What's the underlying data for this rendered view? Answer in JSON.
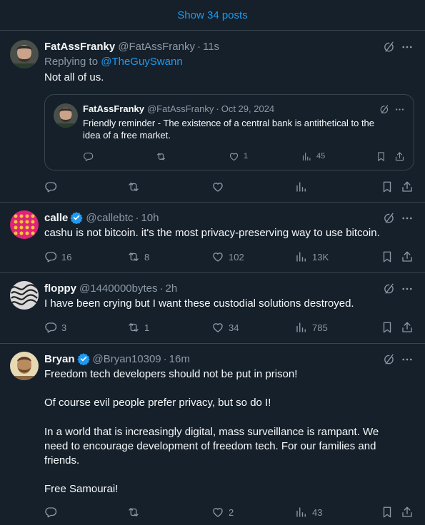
{
  "show_more": {
    "label": "Show 34 posts"
  },
  "post1": {
    "name": "FatAssFranky",
    "handle": "@FatAssFranky",
    "time": "11s",
    "replying_prefix": "Replying to ",
    "replying_handle": "@TheGuySwann",
    "text": "Not all of us.",
    "quote": {
      "name": "FatAssFranky",
      "handle": "@FatAssFranky",
      "time": "Oct 29, 2024",
      "text": "Friendly reminder - The existence of a central bank is antithetical to the idea of a free market.",
      "likes": "1",
      "views": "45"
    }
  },
  "post2": {
    "name": "calle",
    "handle": "@callebtc",
    "time": "10h",
    "text": "cashu is not bitcoin. it's the most privacy-preserving way to use bitcoin.",
    "replies": "16",
    "reposts": "8",
    "likes": "102",
    "views": "13K"
  },
  "post3": {
    "name": "floppy",
    "handle": "@1440000bytes",
    "time": "2h",
    "text": "I have been crying but I want these custodial solutions destroyed.",
    "replies": "3",
    "reposts": "1",
    "likes": "34",
    "views": "785"
  },
  "post4": {
    "name": "Bryan",
    "handle": "@Bryan10309",
    "time": "16m",
    "p1": "Freedom tech developers should not be put in prison!",
    "p2": "Of course evil people prefer privacy, but so do I!",
    "p3": "In a world that is increasingly digital, mass surveillance is rampant.  We need to encourage development of freedom tech.  For our families and friends.",
    "p4": "Free Samourai!",
    "likes": "2",
    "views": "43"
  },
  "colors": {
    "background": "#15202b",
    "accent": "#1d9bf0",
    "muted": "#8b98a5",
    "border": "#38444d"
  }
}
